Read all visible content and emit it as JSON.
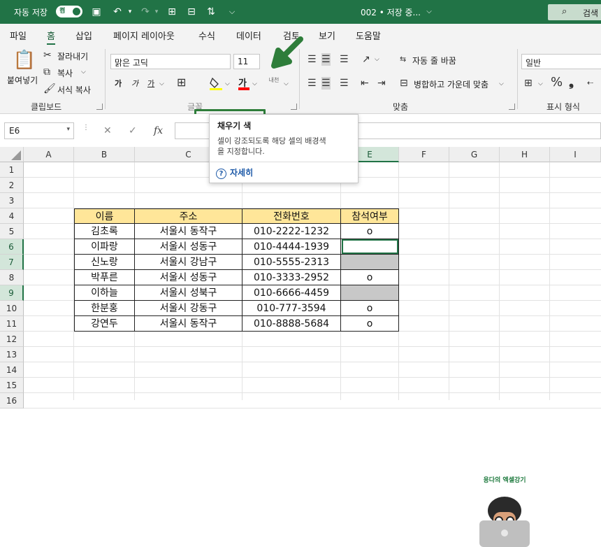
{
  "titlebar": {
    "autosave_label": "자동 저장",
    "toggle_state": "켬",
    "doc_title": "002 • 저장 중...",
    "search_label": "검색"
  },
  "menu": [
    "파일",
    "홈",
    "삽입",
    "페이지 레이아웃",
    "수식",
    "데이터",
    "검토",
    "보기",
    "도움말"
  ],
  "ribbon": {
    "clipboard": {
      "paste": "붙여넣기",
      "cut": "잘라내기",
      "copy": "복사",
      "format_painter": "서식 복사",
      "label": "클립보드"
    },
    "font": {
      "font_name": "맑은 고딕",
      "font_size": "11",
      "bold": "가",
      "italic": "가",
      "underline": "가",
      "font_color_glyph": "가",
      "label": "글꼴",
      "fill_color": "#ffff00",
      "text_color": "#ff0000"
    },
    "alignment": {
      "wrap": "자동 줄 바꿈",
      "merge": "병합하고 가운데 맞춤",
      "label": "맞춤",
      "inner_label": "내천"
    },
    "number": {
      "format": "일반",
      "label": "표시 형식"
    }
  },
  "formula_bar": {
    "name_box": "E6",
    "fx": "fx"
  },
  "tooltip": {
    "title": "채우기 색",
    "desc": "셀이 강조되도록 해당 셀의 배경색을 지정합니다.",
    "help": "자세히"
  },
  "columns": [
    "A",
    "B",
    "C",
    "D",
    "E",
    "F",
    "G",
    "H",
    "I"
  ],
  "rows": [
    "1",
    "2",
    "3",
    "4",
    "5",
    "6",
    "7",
    "8",
    "9",
    "10",
    "11",
    "12",
    "13",
    "14",
    "15",
    "16"
  ],
  "table": {
    "headers": [
      "이름",
      "주소",
      "전화번호",
      "참석여부"
    ],
    "rows": [
      [
        "김초록",
        "서울시 동작구",
        "010-2222-1232",
        "o"
      ],
      [
        "이파랑",
        "서울시 성동구",
        "010-4444-1939",
        ""
      ],
      [
        "신노랑",
        "서울시 강남구",
        "010-5555-2313",
        ""
      ],
      [
        "박푸른",
        "서울시 성동구",
        "010-3333-2952",
        "o"
      ],
      [
        "이하늘",
        "서울시 성북구",
        "010-6666-4459",
        ""
      ],
      [
        "한분홍",
        "서울시 강동구",
        "010-777-3594",
        "o"
      ],
      [
        "강연두",
        "서울시 동작구",
        "010-8888-5684",
        "o"
      ]
    ]
  },
  "avatar_caption": "용다의 엑셀강기"
}
